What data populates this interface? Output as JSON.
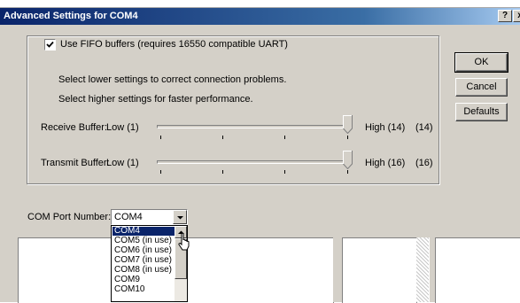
{
  "dialog": {
    "title": "Advanced Settings for COM4",
    "help_button": "?",
    "close_button": "x"
  },
  "fifo": {
    "checked": true,
    "label": "Use FIFO buffers (requires 16550 compatible UART)",
    "hint_lower": "Select lower settings to correct connection problems.",
    "hint_higher": "Select higher settings for faster performance."
  },
  "receive_buffer": {
    "label": "Receive Buffer:",
    "low_label": "Low (1)",
    "high_label": "High (14)",
    "value": "(14)"
  },
  "transmit_buffer": {
    "label": "Transmit Buffer:",
    "low_label": "Low (1)",
    "high_label": "High (16)",
    "value": "(16)"
  },
  "buttons": {
    "ok": "OK",
    "cancel": "Cancel",
    "defaults": "Defaults"
  },
  "com_port": {
    "label": "COM Port Number:",
    "selected": "COM4",
    "options": [
      "COM4",
      "COM5 (in use)",
      "COM6 (in use)",
      "COM7 (in use)",
      "COM8 (in use)",
      "COM9",
      "COM10"
    ]
  },
  "colors": {
    "titlebar": "#0a246a",
    "dialog_bg": "#d4d0c8",
    "selection": "#0a246a"
  }
}
